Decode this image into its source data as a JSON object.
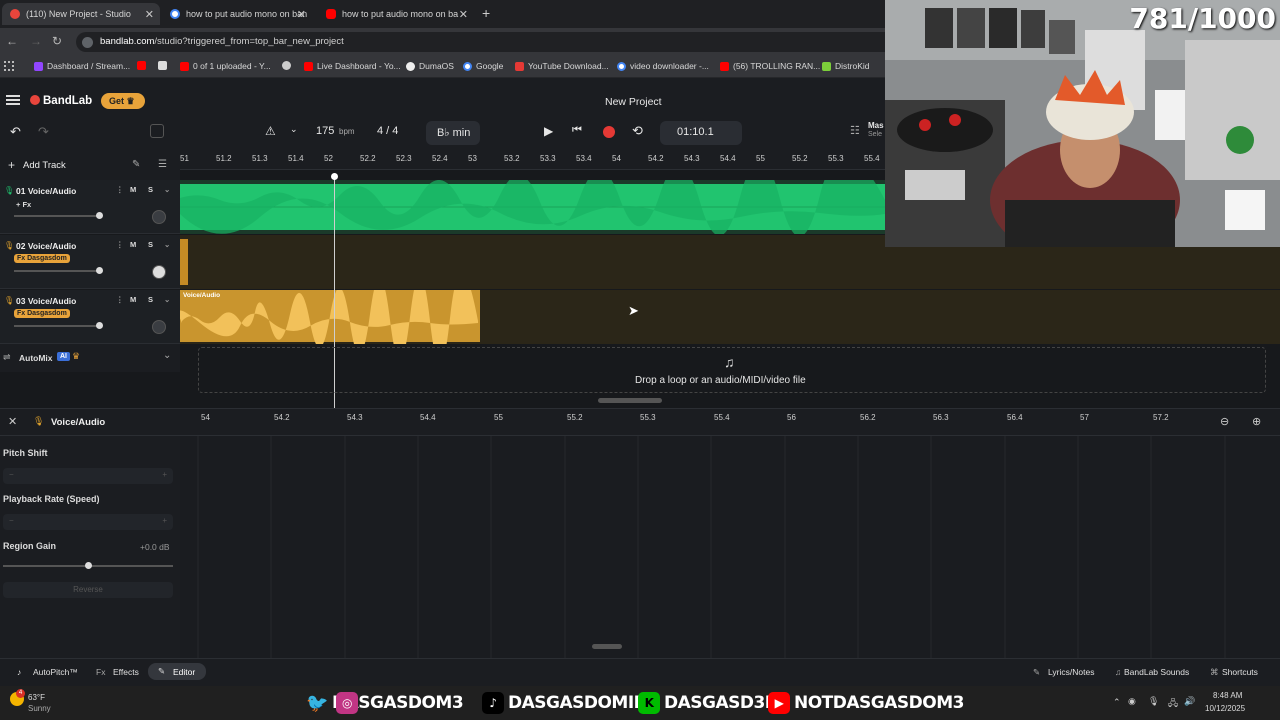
{
  "browser": {
    "tabs": [
      {
        "label": "(110) New Project - Studio",
        "active": true
      },
      {
        "label": "how to put audio mono on ban",
        "active": false
      },
      {
        "label": "how to put audio mono on ba",
        "active": false
      }
    ],
    "url_host": "bandlab.com",
    "url_path": "/studio?triggered_from=top_bar_new_project",
    "bookmarks": [
      "Dashboard / Stream...",
      "0 of 1 uploaded - Y...",
      "Live Dashboard - Yo...",
      "DumaOS",
      "Google",
      "YouTube Download...",
      "video downloader -...",
      "(56) TROLLING RAN...",
      "DistroKid"
    ]
  },
  "app": {
    "logo": "BandLab",
    "get_label": "Get",
    "project_title": "New Project",
    "tempo": "175",
    "tempo_unit": "bpm",
    "time_signature": "4 / 4",
    "key": "B♭ min",
    "time_position": "01:10.1",
    "master_label": "Mas",
    "master_sub": "Sele",
    "add_track_label": "Add Track"
  },
  "ruler": [
    "51",
    "51.2",
    "51.3",
    "51.4",
    "52",
    "52.2",
    "52.3",
    "52.4",
    "53",
    "53.2",
    "53.3",
    "53.4",
    "54",
    "54.2",
    "54.3",
    "54.4",
    "55",
    "55.2",
    "55.3",
    "55.4"
  ],
  "tracks": [
    {
      "number": "01",
      "name": "Voice/Audio",
      "fx": "+ Fx",
      "fx_badge": false,
      "color": "#1ec46f"
    },
    {
      "number": "02",
      "name": "Voice/Audio",
      "fx": "Fx Dasgasdom",
      "fx_badge": true,
      "color": "#e0a22c"
    },
    {
      "number": "03",
      "name": "Voice/Audio",
      "fx": "Fx Dasgasdom",
      "fx_badge": true,
      "color": "#e0a22c"
    }
  ],
  "track_buttons": {
    "mute": "M",
    "solo": "S"
  },
  "region_label": "Voice/Audio",
  "automix": {
    "label": "AutoMix",
    "badge": "AI"
  },
  "dropzone_text": "Drop a loop or an audio/MIDI/video file",
  "editor": {
    "title": "Voice/Audio",
    "ruler": [
      "54",
      "54.2",
      "54.3",
      "54.4",
      "55",
      "55.2",
      "55.3",
      "55.4",
      "56",
      "56.2",
      "56.3",
      "56.4",
      "57",
      "57.2"
    ],
    "pitch_shift": "Pitch Shift",
    "playback_rate": "Playback Rate (Speed)",
    "region_gain": "Region Gain",
    "region_gain_value": "+0.0 dB",
    "reverse": "Reverse"
  },
  "bottom": {
    "autopitch": "AutoPitch™",
    "effects": "Effects",
    "editor": "Editor",
    "lyrics": "Lyrics/Notes",
    "sounds": "BandLab Sounds",
    "shortcuts": "Shortcuts"
  },
  "taskbar": {
    "weather_temp": "63°F",
    "weather_desc": "Sunny",
    "weather_badge": "4",
    "time": "8:48 AM",
    "date": "10/12/2025",
    "socials": [
      "DASGASDOM3",
      "DASGASDOMINI",
      "DASGASD3M",
      "NOTDASGASDOM3"
    ]
  },
  "overlay_counter": "781/1000"
}
